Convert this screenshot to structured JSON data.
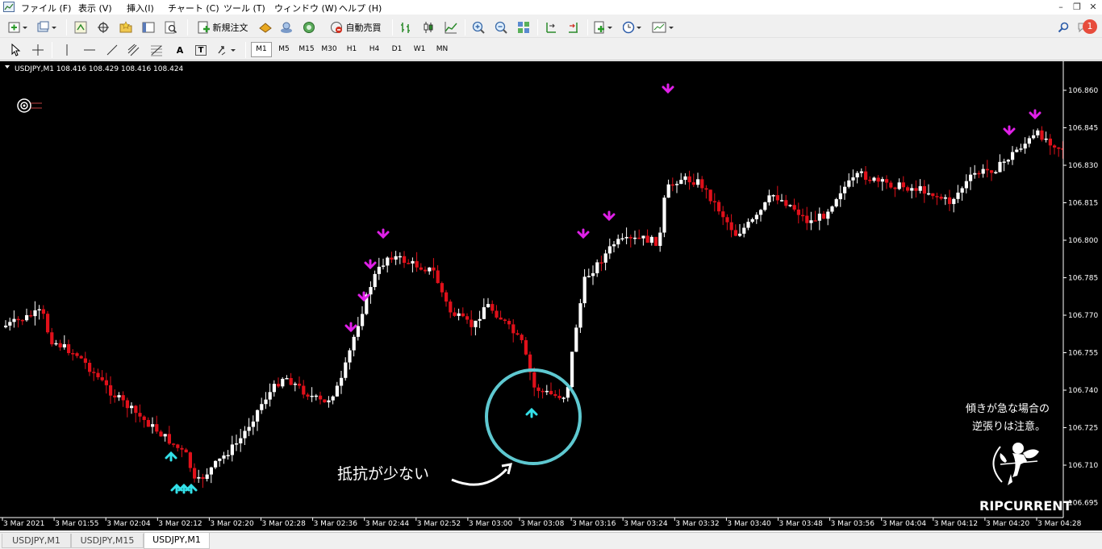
{
  "menu": [
    "ファイル (F)",
    "表示 (V)",
    "挿入(I)",
    "チャート (C)",
    "ツール (T)",
    "ウィンドウ (W)",
    "ヘルプ (H)"
  ],
  "toolbar": {
    "new_order_label": "新規注文",
    "auto_trade_label": "自動売買",
    "timeframes": [
      "M1",
      "M5",
      "M15",
      "M30",
      "H1",
      "H4",
      "D1",
      "W1",
      "MN"
    ],
    "active_timeframe": "M1",
    "text_tool": "A",
    "label_tool": "T",
    "alert_count": "1"
  },
  "chart": {
    "header": "USDJPY,M1  108.416 108.429 108.416 108.424",
    "price_ticks": [
      "106.860",
      "106.845",
      "106.830",
      "106.815",
      "106.800",
      "106.785",
      "106.770",
      "106.755",
      "106.740",
      "106.725",
      "106.710",
      "106.695"
    ],
    "time_ticks": [
      "3 Mar 2021",
      "3 Mar 01:55",
      "3 Mar 02:04",
      "3 Mar 02:12",
      "3 Mar 02:20",
      "3 Mar 02:28",
      "3 Mar 02:36",
      "3 Mar 02:44",
      "3 Mar 02:52",
      "3 Mar 03:00",
      "3 Mar 03:08",
      "3 Mar 03:16",
      "3 Mar 03:24",
      "3 Mar 03:32",
      "3 Mar 03:40",
      "3 Mar 03:48",
      "3 Mar 03:56",
      "3 Mar 04:04",
      "3 Mar 04:12",
      "3 Mar 04:20",
      "3 Mar 04:28"
    ],
    "annotation_low_resistance": "抵抗が少ない",
    "note_line1": "傾きが急な場合の",
    "note_line2": "逆張りは注意。",
    "logo_text": "RIPCURRENT",
    "colors": {
      "bull": "#ffffff",
      "bear": "#e0101a",
      "up_arrow": "#33e0e8",
      "down_arrow": "#e020e8",
      "circle": "#5ec8d0"
    }
  },
  "tabs": [
    "USDJPY,M1",
    "USDJPY,M15",
    "USDJPY,M1"
  ],
  "active_tab": 2
}
